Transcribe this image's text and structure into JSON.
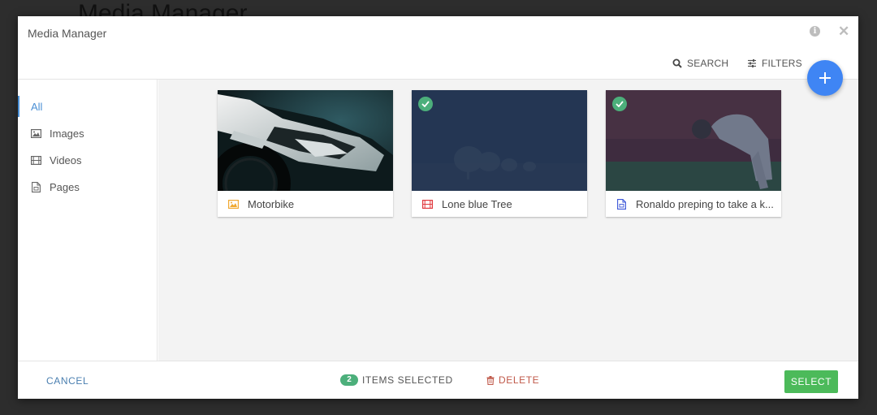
{
  "background_title": "Media Manager",
  "modal": {
    "title": "Media Manager",
    "info_icon": "info-icon",
    "close_icon": "close-icon"
  },
  "toolbar": {
    "search_label": "SEARCH",
    "filters_label": "FILTERS",
    "add_icon": "plus-icon"
  },
  "sidebar": {
    "items": [
      {
        "label": "All",
        "icon": "",
        "active": true
      },
      {
        "label": "Images",
        "icon": "image-icon",
        "active": false
      },
      {
        "label": "Videos",
        "icon": "film-icon",
        "active": false
      },
      {
        "label": "Pages",
        "icon": "page-icon",
        "active": false
      }
    ]
  },
  "media": {
    "items": [
      {
        "label": "Motorbike",
        "type_icon": "image-icon",
        "type_color": "#f0a830",
        "selected": false
      },
      {
        "label": "Lone blue Tree",
        "type_icon": "film-icon",
        "type_color": "#e0393e",
        "selected": true
      },
      {
        "label": "Ronaldo preping to take a k...",
        "type_icon": "page-icon",
        "type_color": "#3a55d8",
        "selected": true
      }
    ]
  },
  "footer": {
    "cancel_label": "CANCEL",
    "selected_count": "2",
    "selected_label": "ITEMS SELECTED",
    "delete_label": "DELETE",
    "select_label": "SELECT"
  },
  "colors": {
    "accent_blue": "#3f85f4",
    "success_green": "#4cba5a",
    "badge_green": "#4caf7b",
    "delete_red": "#c0594a",
    "link_blue": "#4a7fb0"
  }
}
